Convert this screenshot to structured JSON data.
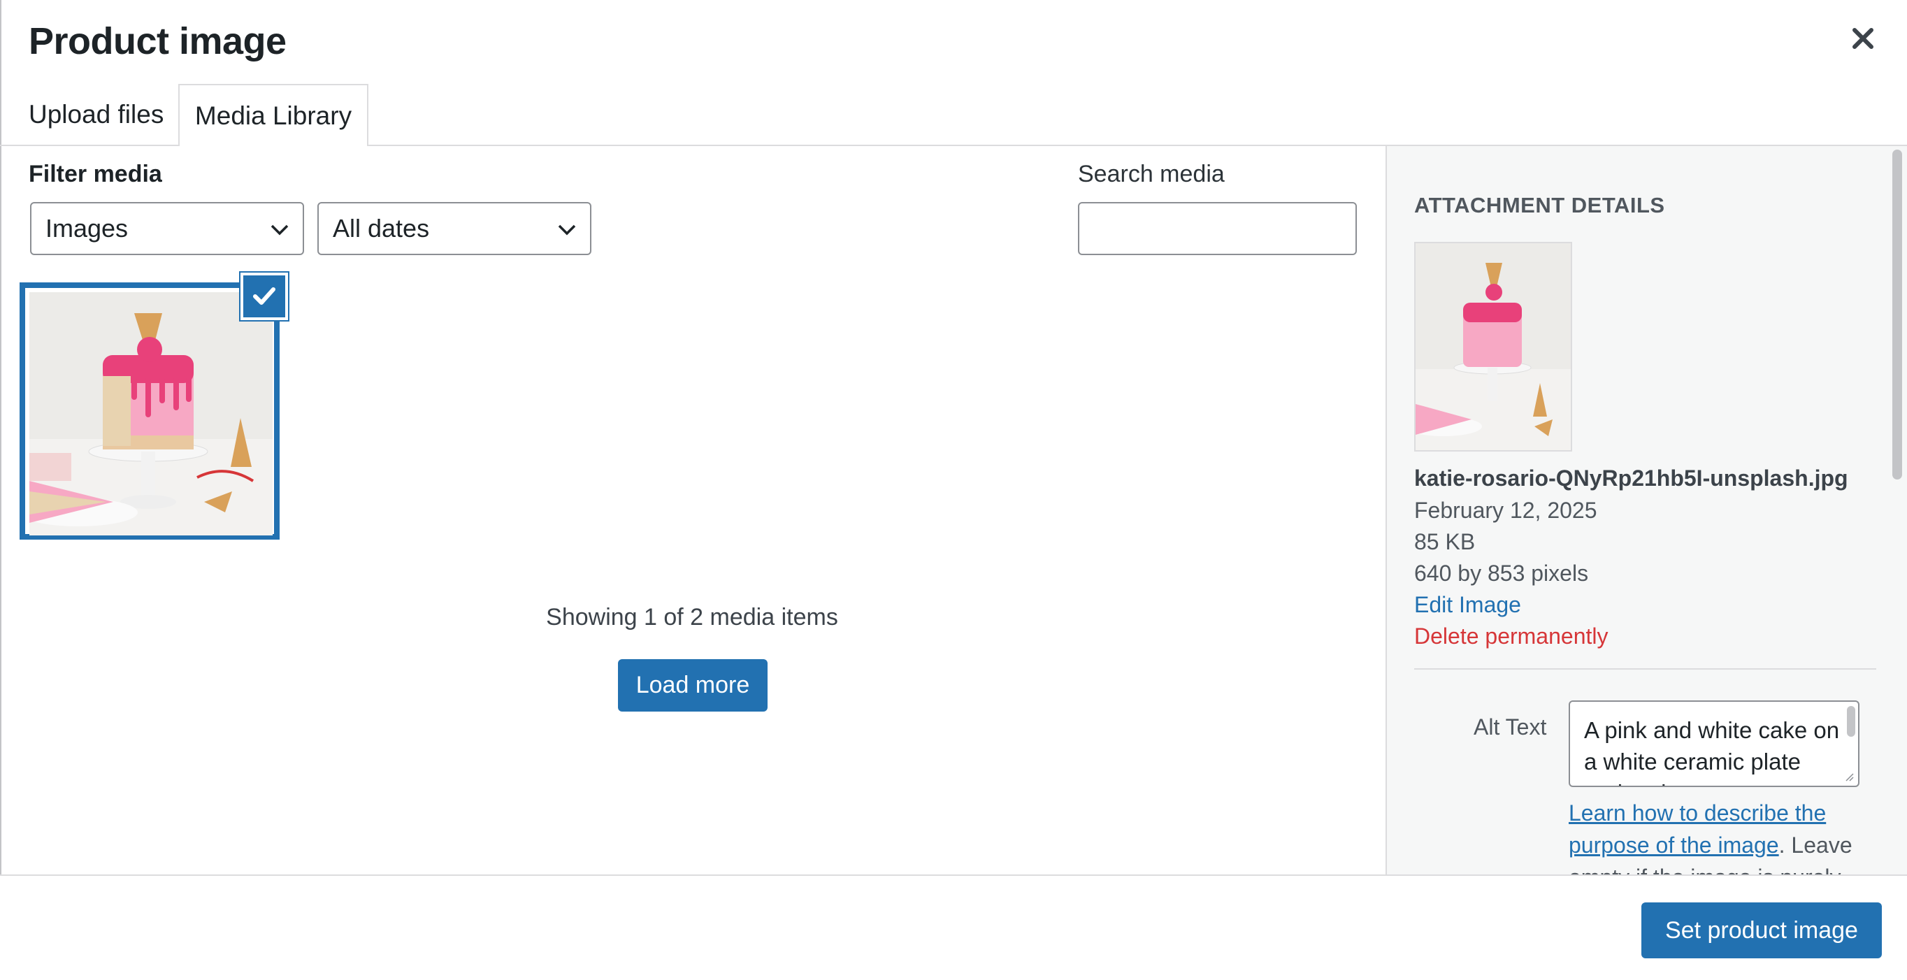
{
  "modal": {
    "title": "Product image",
    "close_icon": "close-icon"
  },
  "tabs": [
    {
      "label": "Upload files",
      "active": false
    },
    {
      "label": "Media Library",
      "active": true
    }
  ],
  "filters": {
    "label": "Filter media",
    "type_select": {
      "value": "Images"
    },
    "date_select": {
      "value": "All dates"
    }
  },
  "search": {
    "label": "Search media",
    "value": ""
  },
  "library": {
    "items": [
      {
        "selected": true,
        "description": "cake-thumbnail"
      }
    ],
    "showing_text": "Showing 1 of 2 media items",
    "load_more_label": "Load more"
  },
  "attachment": {
    "heading": "ATTACHMENT DETAILS",
    "filename": "katie-rosario-QNyRp21hb5I-unsplash.jpg",
    "date": "February 12, 2025",
    "size": "85 KB",
    "dimensions": "640 by 853 pixels",
    "edit_label": "Edit Image",
    "delete_label": "Delete permanently",
    "alt_label": "Alt Text",
    "alt_value": "A pink and white cake on a white ceramic plate and an ice cream",
    "help_link": "Learn how to describe the purpose of the image",
    "help_rest": ". Leave empty if the image is purely"
  },
  "footer": {
    "set_button_label": "Set product image"
  },
  "colors": {
    "accent": "#2271b1",
    "danger": "#d63638",
    "sidebar_bg": "#f6f7f7"
  }
}
